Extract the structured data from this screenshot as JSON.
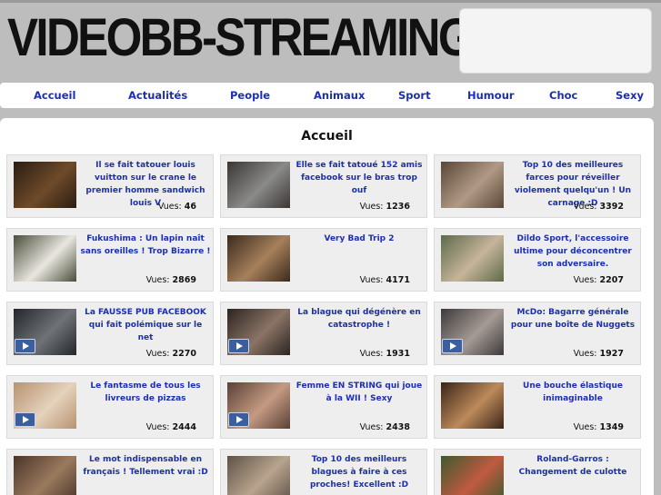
{
  "site": {
    "logo_text": "VIDEOBB-STREAMING"
  },
  "nav": [
    "Accueil",
    "Actualités",
    "People",
    "Animaux",
    "Sport",
    "Humour",
    "Choc",
    "Sexy"
  ],
  "page_title": "Accueil",
  "views_label": "Vues:",
  "videos": [
    {
      "title": "Il se fait tatouer louis vuitton sur le crane le premier homme sandwich louis V",
      "views": "46",
      "has_play": false,
      "thumb_colors": [
        "#2a1d12",
        "#6e4a2a"
      ]
    },
    {
      "title": "Elle se fait tatoué 152 amis facebook sur le bras trop ouf",
      "views": "1236",
      "has_play": false,
      "thumb_colors": [
        "#3a3634",
        "#8a8a88"
      ]
    },
    {
      "title": "Top 10 des meilleures farces pour réveiller violement quelqu'un ! Un carnage :D",
      "views": "3392",
      "has_play": false,
      "thumb_colors": [
        "#5a4638",
        "#b09a86"
      ]
    },
    {
      "title": "Fukushima : Un lapin naît sans oreilles ! Trop Bizarre !",
      "views": "2869",
      "has_play": false,
      "thumb_colors": [
        "#4b4e3a",
        "#e8e6e0"
      ]
    },
    {
      "title": "Very Bad Trip 2",
      "views": "4171",
      "has_play": false,
      "thumb_colors": [
        "#3b2a1e",
        "#a6805a"
      ]
    },
    {
      "title": "Dildo Sport, l'accessoire ultime pour déconcentrer son adversaire.",
      "views": "2207",
      "has_play": false,
      "thumb_colors": [
        "#5e6a4a",
        "#c6b49a"
      ]
    },
    {
      "title": "La FAUSSE PUB FACEBOOK qui fait polémique sur le net",
      "views": "2270",
      "has_play": true,
      "thumb_colors": [
        "#23262b",
        "#6f7378"
      ]
    },
    {
      "title": "La blague qui dégénère en catastrophe !",
      "views": "1931",
      "has_play": true,
      "thumb_colors": [
        "#2c2420",
        "#8a7466"
      ]
    },
    {
      "title": "McDo: Bagarre générale pour une boîte de Nuggets",
      "views": "1927",
      "has_play": true,
      "thumb_colors": [
        "#3d3a3c",
        "#a59a94"
      ]
    },
    {
      "title": "Le fantasme de tous les livreurs de pizzas",
      "views": "2444",
      "has_play": true,
      "thumb_colors": [
        "#b89270",
        "#e4d2bc"
      ]
    },
    {
      "title": "Femme EN STRING qui joue à la WII ! Sexy",
      "views": "2438",
      "has_play": true,
      "thumb_colors": [
        "#5a4036",
        "#c49a82"
      ]
    },
    {
      "title": "Une bouche élastique inimaginable",
      "views": "1349",
      "has_play": false,
      "thumb_colors": [
        "#3a2418",
        "#bd8a5a"
      ]
    },
    {
      "title": "Le mot indispensable en français ! Tellement vrai :D",
      "views": "",
      "has_play": false,
      "thumb_colors": [
        "#4a3428",
        "#9a7a5e"
      ]
    },
    {
      "title": "Top 10 des meilleurs blagues à faire à ces proches! Excellent :D",
      "views": "",
      "has_play": false,
      "thumb_colors": [
        "#5e5246",
        "#b8a48e"
      ]
    },
    {
      "title": "Roland-Garros : Changement de culotte",
      "views": "",
      "has_play": false,
      "thumb_colors": [
        "#3e5a2e",
        "#c05a40"
      ]
    }
  ]
}
